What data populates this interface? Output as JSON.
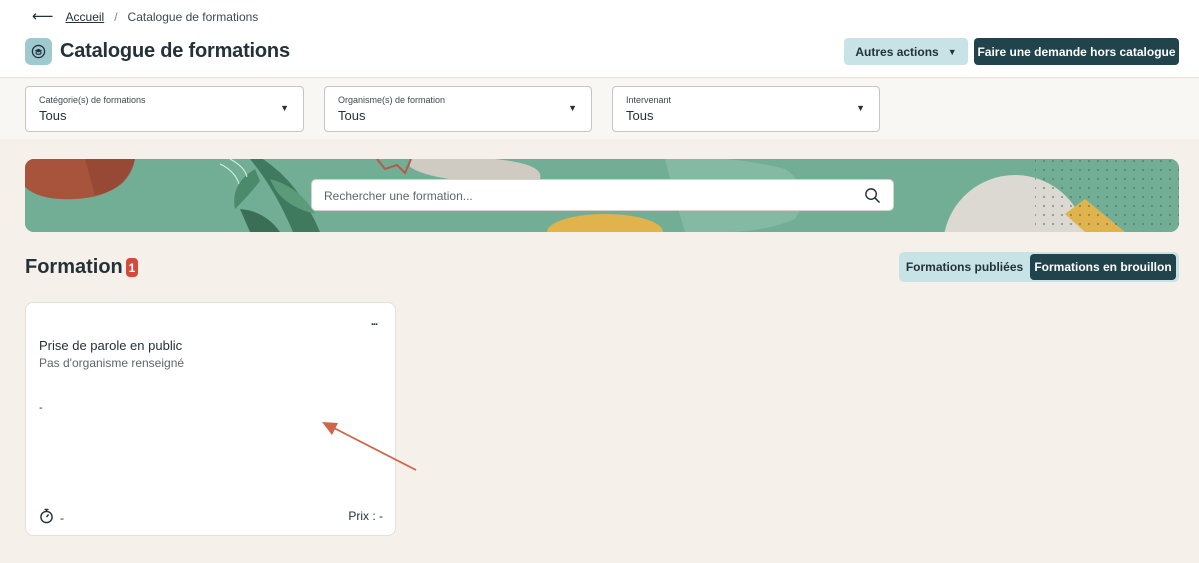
{
  "breadcrumb": {
    "home": "Accueil",
    "separator": "/",
    "current": "Catalogue de formations"
  },
  "header": {
    "title": "Catalogue de formations",
    "icon": "graduation-cap-icon",
    "more_actions": "Autres actions",
    "request_button": "Faire une demande hors catalogue"
  },
  "filters": [
    {
      "label": "Catégorie(s) de formations",
      "value": "Tous"
    },
    {
      "label": "Organisme(s) de formation",
      "value": "Tous"
    },
    {
      "label": "Intervenant",
      "value": "Tous"
    }
  ],
  "search": {
    "placeholder": "Rechercher une formation..."
  },
  "section": {
    "title": "Formation",
    "count": "1"
  },
  "view_toggle": {
    "published": "Formations publiées",
    "draft": "Formations en brouillon",
    "selected": "draft"
  },
  "cards": [
    {
      "menu": "...",
      "title": "Prise de parole en public",
      "organism": "Pas d'organisme renseigné",
      "description": "-",
      "duration": "-",
      "price": "Prix : -"
    }
  ],
  "colors": {
    "primary_dark": "#21434b",
    "primary_light": "#c8e3e6",
    "badge_red": "#d44a3a",
    "page_bg": "#f5f0e9",
    "annotation_arrow": "#d0654a"
  }
}
